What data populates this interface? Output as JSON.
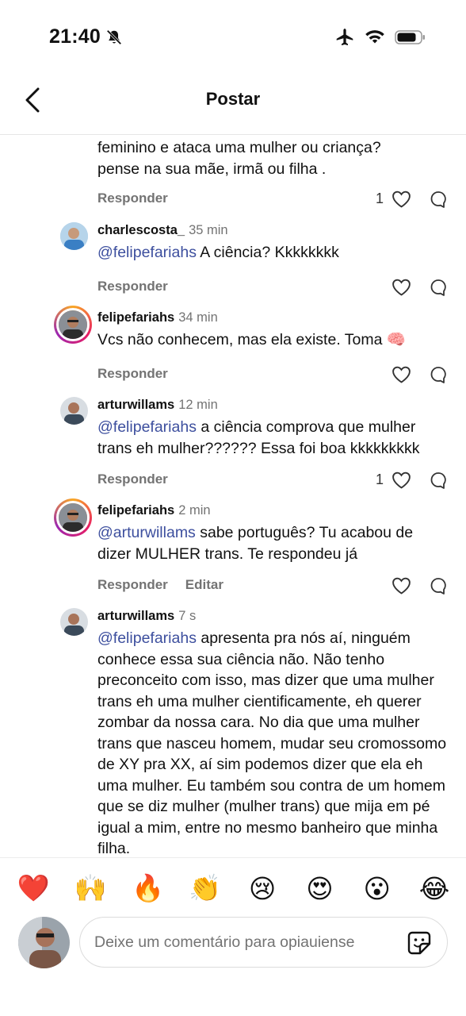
{
  "status_bar": {
    "time": "21:40"
  },
  "header": {
    "title": "Postar"
  },
  "comments": [
    {
      "text_lines": [
        "feminino e ataca uma mulher ou criança?",
        "pense na sua mãe, irmã ou filha ."
      ],
      "reply_label": "Responder",
      "like_count": "1"
    },
    {
      "username": "charlescosta_",
      "time": "35 min",
      "mention": "@felipefariahs",
      "text": " A ciência? Kkkkkkkk",
      "reply_label": "Responder"
    },
    {
      "username": "felipefariahs",
      "time": "34 min",
      "text": "Vcs não conhecem, mas ela existe. Toma 🧠",
      "reply_label": "Responder"
    },
    {
      "username": "arturwillams",
      "time": "12 min",
      "mention": "@felipefariahs",
      "text": " a ciência comprova que mulher trans eh mulher?????? Essa foi boa kkkkkkkkk",
      "reply_label": "Responder",
      "like_count": "1"
    },
    {
      "username": "felipefariahs",
      "time": "2 min",
      "mention": "@arturwillams",
      "text": " sabe português? Tu acabou de dizer MULHER trans. Te respondeu já",
      "reply_label": "Responder",
      "edit_label": "Editar"
    },
    {
      "username": "arturwillams",
      "time": "7 s",
      "mention": "@felipefariahs",
      "text": " apresenta pra nós aí, ninguém conhece essa sua ciência não. Não tenho preconceito com isso, mas dizer que uma mulher trans eh uma mulher cientificamente, eh querer zombar da nossa cara. No dia que uma mulher trans que nasceu homem, mudar seu cromossomo de XY pra XX, aí sim podemos dizer que ela eh uma mulher. Eu também sou contra de um homem que se diz mulher (mulher trans) que mija em pé igual a mim, entre no mesmo banheiro que minha filha."
    }
  ],
  "emoji_bar": [
    "❤️",
    "🙌",
    "🔥",
    "👏",
    "😢",
    "😍",
    "😮",
    "😂"
  ],
  "composer": {
    "placeholder": "Deixe um comentário para opiauiense"
  }
}
